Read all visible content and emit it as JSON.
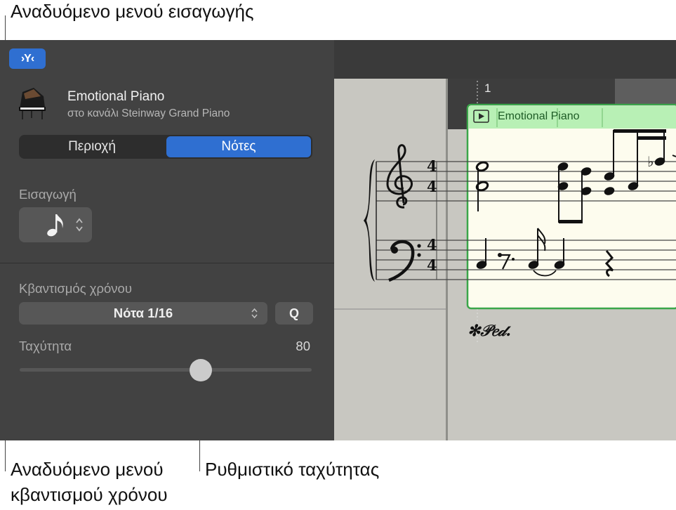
{
  "callouts": {
    "insert_popup": "Αναδυόμενο μενού εισαγωγής",
    "quantize_popup_line1": "Αναδυόμενο μενού",
    "quantize_popup_line2": "κβαντισμού χρόνου",
    "velocity_slider": "Ρυθμιστικό ταχύτητας"
  },
  "toolbar": {
    "inspector_glyph": "›Y‹"
  },
  "track": {
    "name": "Emotional Piano",
    "channel": "στο κανάλι Steinway Grand Piano"
  },
  "segmented": {
    "region_label": "Περιοχή",
    "notes_label": "Νότες",
    "selected": "Νότες"
  },
  "insert": {
    "label": "Εισαγωγή",
    "value_icon": "eighth-note-icon"
  },
  "quantize": {
    "label": "Κβαντισμός χρόνου",
    "value": "Νότα 1/16",
    "q_label": "Q"
  },
  "velocity": {
    "label": "Ταχύτητα",
    "value": "80",
    "level_fraction": 0.62
  },
  "score": {
    "bar_number": "1",
    "region_name": "Emotional Piano",
    "time_signature_top": "4",
    "time_signature_bottom": "4",
    "pedal_mark": "✻𝒫𝑒𝒹."
  },
  "colors": {
    "accent": "#2f6fd1",
    "panel_bg": "#424242",
    "score_bg": "#c8c7c1",
    "region_border": "#3aa64a",
    "region_header": "#b8f0b5",
    "region_body": "#fdfcee"
  }
}
